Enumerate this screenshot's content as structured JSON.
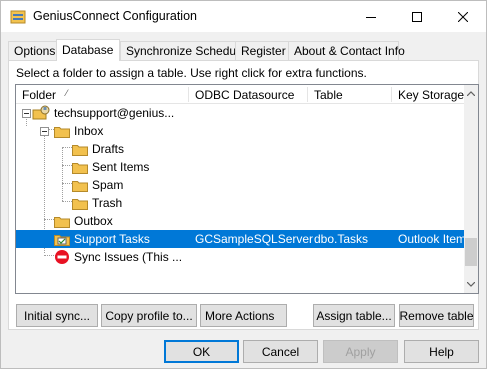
{
  "window": {
    "title": "GeniusConnect Configuration"
  },
  "tabs": [
    {
      "label": "Options",
      "active": false
    },
    {
      "label": "Database",
      "active": true
    },
    {
      "label": "Synchronize Schedule",
      "active": false
    },
    {
      "label": "Register",
      "active": false
    },
    {
      "label": "About & Contact Info",
      "active": false
    }
  ],
  "instruction": "Select a folder to assign a table. Use right click for extra functions.",
  "columns": {
    "folder": "Folder",
    "datasource": "ODBC Datasource",
    "table": "Table",
    "key_storage": "Key Storage"
  },
  "tree": {
    "root": "techsupport@genius...",
    "inbox": "Inbox",
    "drafts": "Drafts",
    "sent_items": "Sent Items",
    "spam": "Spam",
    "trash": "Trash",
    "outbox": "Outbox",
    "support_tasks": {
      "label": "Support Tasks",
      "datasource": "GCSampleSQLServer",
      "table": "dbo.Tasks",
      "key_storage": "Outlook Item"
    },
    "sync_issues": "Sync Issues (This ..."
  },
  "actions": {
    "initial_sync": "Initial sync...",
    "copy_profile": "Copy profile to...",
    "more_actions": "More Actions",
    "assign_table": "Assign table...",
    "remove_table": "Remove table"
  },
  "dialog": {
    "ok": "OK",
    "cancel": "Cancel",
    "apply": "Apply",
    "help": "Help"
  },
  "colors": {
    "selection": "#0078d7",
    "folder": "#f2c14e",
    "no_entry": "#e81123"
  }
}
